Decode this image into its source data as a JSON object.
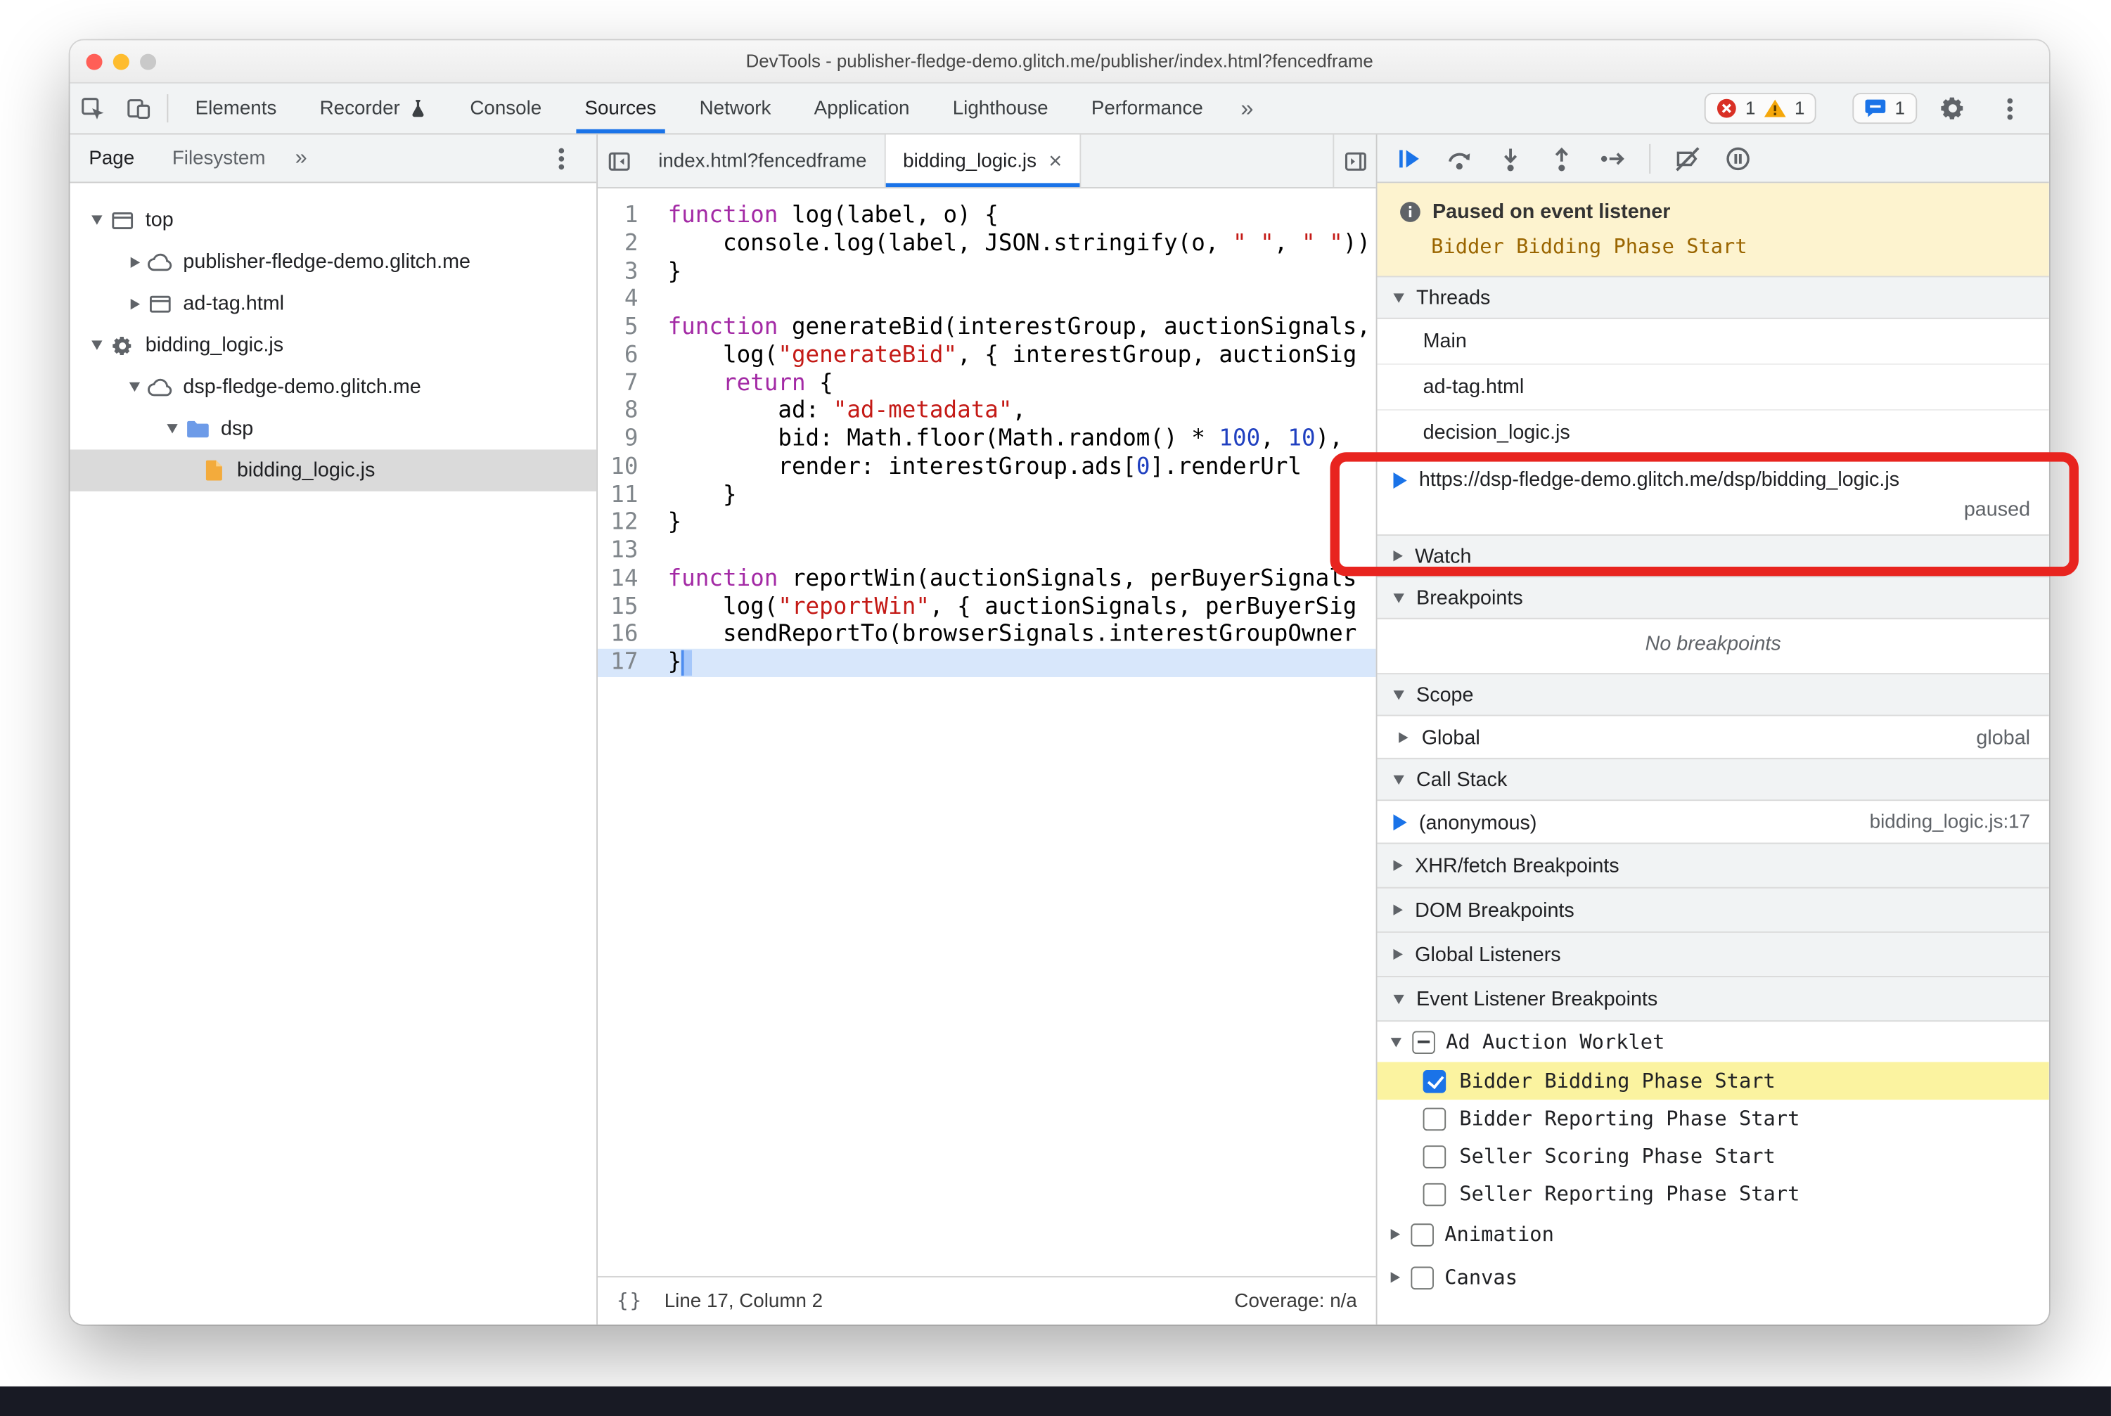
{
  "colors": {
    "accent": "#1a73e8",
    "error": "#d93025",
    "warning": "#f5a70a",
    "annotation_red": "#e8241f",
    "paused_banner_bg": "#fdf3cf",
    "breakpoint_highlight": "#fbf3a0",
    "keyword": "#a32aa5",
    "string": "#c41a16",
    "number": "#2040c0",
    "folder_icon": "#6d9be8",
    "file_icon": "#f3ab3c"
  },
  "window": {
    "title": "DevTools - publisher-fledge-demo.glitch.me/publisher/index.html?fencedframe"
  },
  "main_toolbar": {
    "tabs": [
      {
        "label": "Elements"
      },
      {
        "label": "Recorder",
        "badge": "experiment-flask-icon"
      },
      {
        "label": "Console"
      },
      {
        "label": "Sources",
        "active": true
      },
      {
        "label": "Network"
      },
      {
        "label": "Application"
      },
      {
        "label": "Lighthouse"
      },
      {
        "label": "Performance"
      }
    ],
    "more_tabs": "»",
    "errors": "1",
    "warnings": "1",
    "issues": "1"
  },
  "navigator": {
    "tabs": [
      {
        "label": "Page",
        "active": true
      },
      {
        "label": "Filesystem",
        "active": false
      }
    ],
    "more": "»",
    "tree": [
      {
        "label": "top",
        "level": 0,
        "icon": "frame-icon",
        "disclosure": "open"
      },
      {
        "label": "publisher-fledge-demo.glitch.me",
        "level": 1,
        "icon": "cloud-icon",
        "disclosure": "closed"
      },
      {
        "label": "ad-tag.html",
        "level": 1,
        "icon": "frame-icon",
        "disclosure": "closed"
      },
      {
        "label": "bidding_logic.js",
        "level": 0,
        "icon": "gear-icon",
        "disclosure": "open"
      },
      {
        "label": "dsp-fledge-demo.glitch.me",
        "level": 1,
        "icon": "cloud-icon",
        "disclosure": "open"
      },
      {
        "label": "dsp",
        "level": 2,
        "icon": "folder-icon",
        "disclosure": "open"
      },
      {
        "label": "bidding_logic.js",
        "level": 3,
        "icon": "file-script-icon",
        "disclosure": "none",
        "selected": true
      }
    ]
  },
  "editor": {
    "tabs": [
      {
        "label": "index.html?fencedframe",
        "active": false
      },
      {
        "label": "bidding_logic.js",
        "active": true,
        "close": "×"
      }
    ],
    "lines": [
      {
        "n": 1,
        "seg": [
          {
            "t": "function",
            "c": "kw"
          },
          {
            "t": " log(label, o) {"
          }
        ]
      },
      {
        "n": 2,
        "seg": [
          {
            "t": "    console.log(label, JSON.stringify(o, "
          },
          {
            "t": "\" \"",
            "c": "str"
          },
          {
            "t": ", "
          },
          {
            "t": "\" \"",
            "c": "str"
          },
          {
            "t": "))"
          }
        ]
      },
      {
        "n": 3,
        "seg": [
          {
            "t": "}"
          }
        ]
      },
      {
        "n": 4,
        "seg": []
      },
      {
        "n": 5,
        "seg": [
          {
            "t": "function",
            "c": "kw"
          },
          {
            "t": " generateBid(interestGroup, auctionSignals,"
          }
        ]
      },
      {
        "n": 6,
        "seg": [
          {
            "t": "    log("
          },
          {
            "t": "\"generateBid\"",
            "c": "str"
          },
          {
            "t": ", { interestGroup, auctionSig"
          }
        ]
      },
      {
        "n": 7,
        "seg": [
          {
            "t": "    "
          },
          {
            "t": "return",
            "c": "kw"
          },
          {
            "t": " {"
          }
        ]
      },
      {
        "n": 8,
        "seg": [
          {
            "t": "        ad: "
          },
          {
            "t": "\"ad-metadata\"",
            "c": "str"
          },
          {
            "t": ","
          }
        ]
      },
      {
        "n": 9,
        "seg": [
          {
            "t": "        bid: Math.floor(Math.random() * "
          },
          {
            "t": "100",
            "c": "num"
          },
          {
            "t": ", "
          },
          {
            "t": "10",
            "c": "num"
          },
          {
            "t": "),"
          }
        ]
      },
      {
        "n": 10,
        "seg": [
          {
            "t": "        render: interestGroup.ads["
          },
          {
            "t": "0",
            "c": "num"
          },
          {
            "t": "].renderUrl"
          }
        ]
      },
      {
        "n": 11,
        "seg": [
          {
            "t": "    }"
          }
        ]
      },
      {
        "n": 12,
        "seg": [
          {
            "t": "}"
          }
        ]
      },
      {
        "n": 13,
        "seg": []
      },
      {
        "n": 14,
        "seg": [
          {
            "t": "function",
            "c": "kw"
          },
          {
            "t": " reportWin(auctionSignals, perBuyerSignals"
          }
        ]
      },
      {
        "n": 15,
        "seg": [
          {
            "t": "    log("
          },
          {
            "t": "\"reportWin\"",
            "c": "str"
          },
          {
            "t": ", { auctionSignals, perBuyerSig"
          }
        ]
      },
      {
        "n": 16,
        "seg": [
          {
            "t": "    sendReportTo(browserSignals.interestGroupOwner"
          }
        ]
      },
      {
        "n": 17,
        "seg": [
          {
            "t": "}"
          }
        ],
        "current": true
      }
    ],
    "status": {
      "format": "{}",
      "position": "Line 17, Column 2",
      "coverage": "Coverage: n/a"
    }
  },
  "debugger": {
    "paused": {
      "title": "Paused on event listener",
      "detail": "Bidder Bidding Phase Start"
    },
    "threads": {
      "title": "Threads",
      "items": [
        {
          "label": "Main"
        },
        {
          "label": "ad-tag.html"
        },
        {
          "label": "decision_logic.js"
        },
        {
          "label": "https://dsp-fledge-demo.glitch.me/dsp/bidding_logic.js",
          "status": "paused",
          "current": true
        }
      ]
    },
    "watch_title": "Watch",
    "breakpoints_title": "Breakpoints",
    "breakpoints_empty": "No breakpoints",
    "scope_title": "Scope",
    "scope_rows": [
      {
        "label": "Global",
        "value": "global"
      }
    ],
    "call_stack_title": "Call Stack",
    "call_stack_rows": [
      {
        "label": "(anonymous)",
        "location": "bidding_logic.js:17",
        "current": true
      }
    ],
    "xhr_title": "XHR/fetch Breakpoints",
    "dom_title": "DOM Breakpoints",
    "global_listeners_title": "Global Listeners",
    "elb_title": "Event Listener Breakpoints",
    "elb_rows": [
      {
        "label": "Ad Auction Worklet",
        "type": "group",
        "checkbox": "indeterminate",
        "disclosure": "open"
      },
      {
        "label": "Bidder Bidding Phase Start",
        "type": "child",
        "checkbox": "checked",
        "highlighted": true
      },
      {
        "label": "Bidder Reporting Phase Start",
        "type": "child",
        "checkbox": "unchecked"
      },
      {
        "label": "Seller Scoring Phase Start",
        "type": "child",
        "checkbox": "unchecked"
      },
      {
        "label": "Seller Reporting Phase Start",
        "type": "child",
        "checkbox": "unchecked"
      },
      {
        "label": "Animation",
        "type": "group",
        "checkbox": "unchecked",
        "disclosure": "closed"
      },
      {
        "label": "Canvas",
        "type": "group",
        "checkbox": "unchecked",
        "disclosure": "closed"
      }
    ]
  }
}
